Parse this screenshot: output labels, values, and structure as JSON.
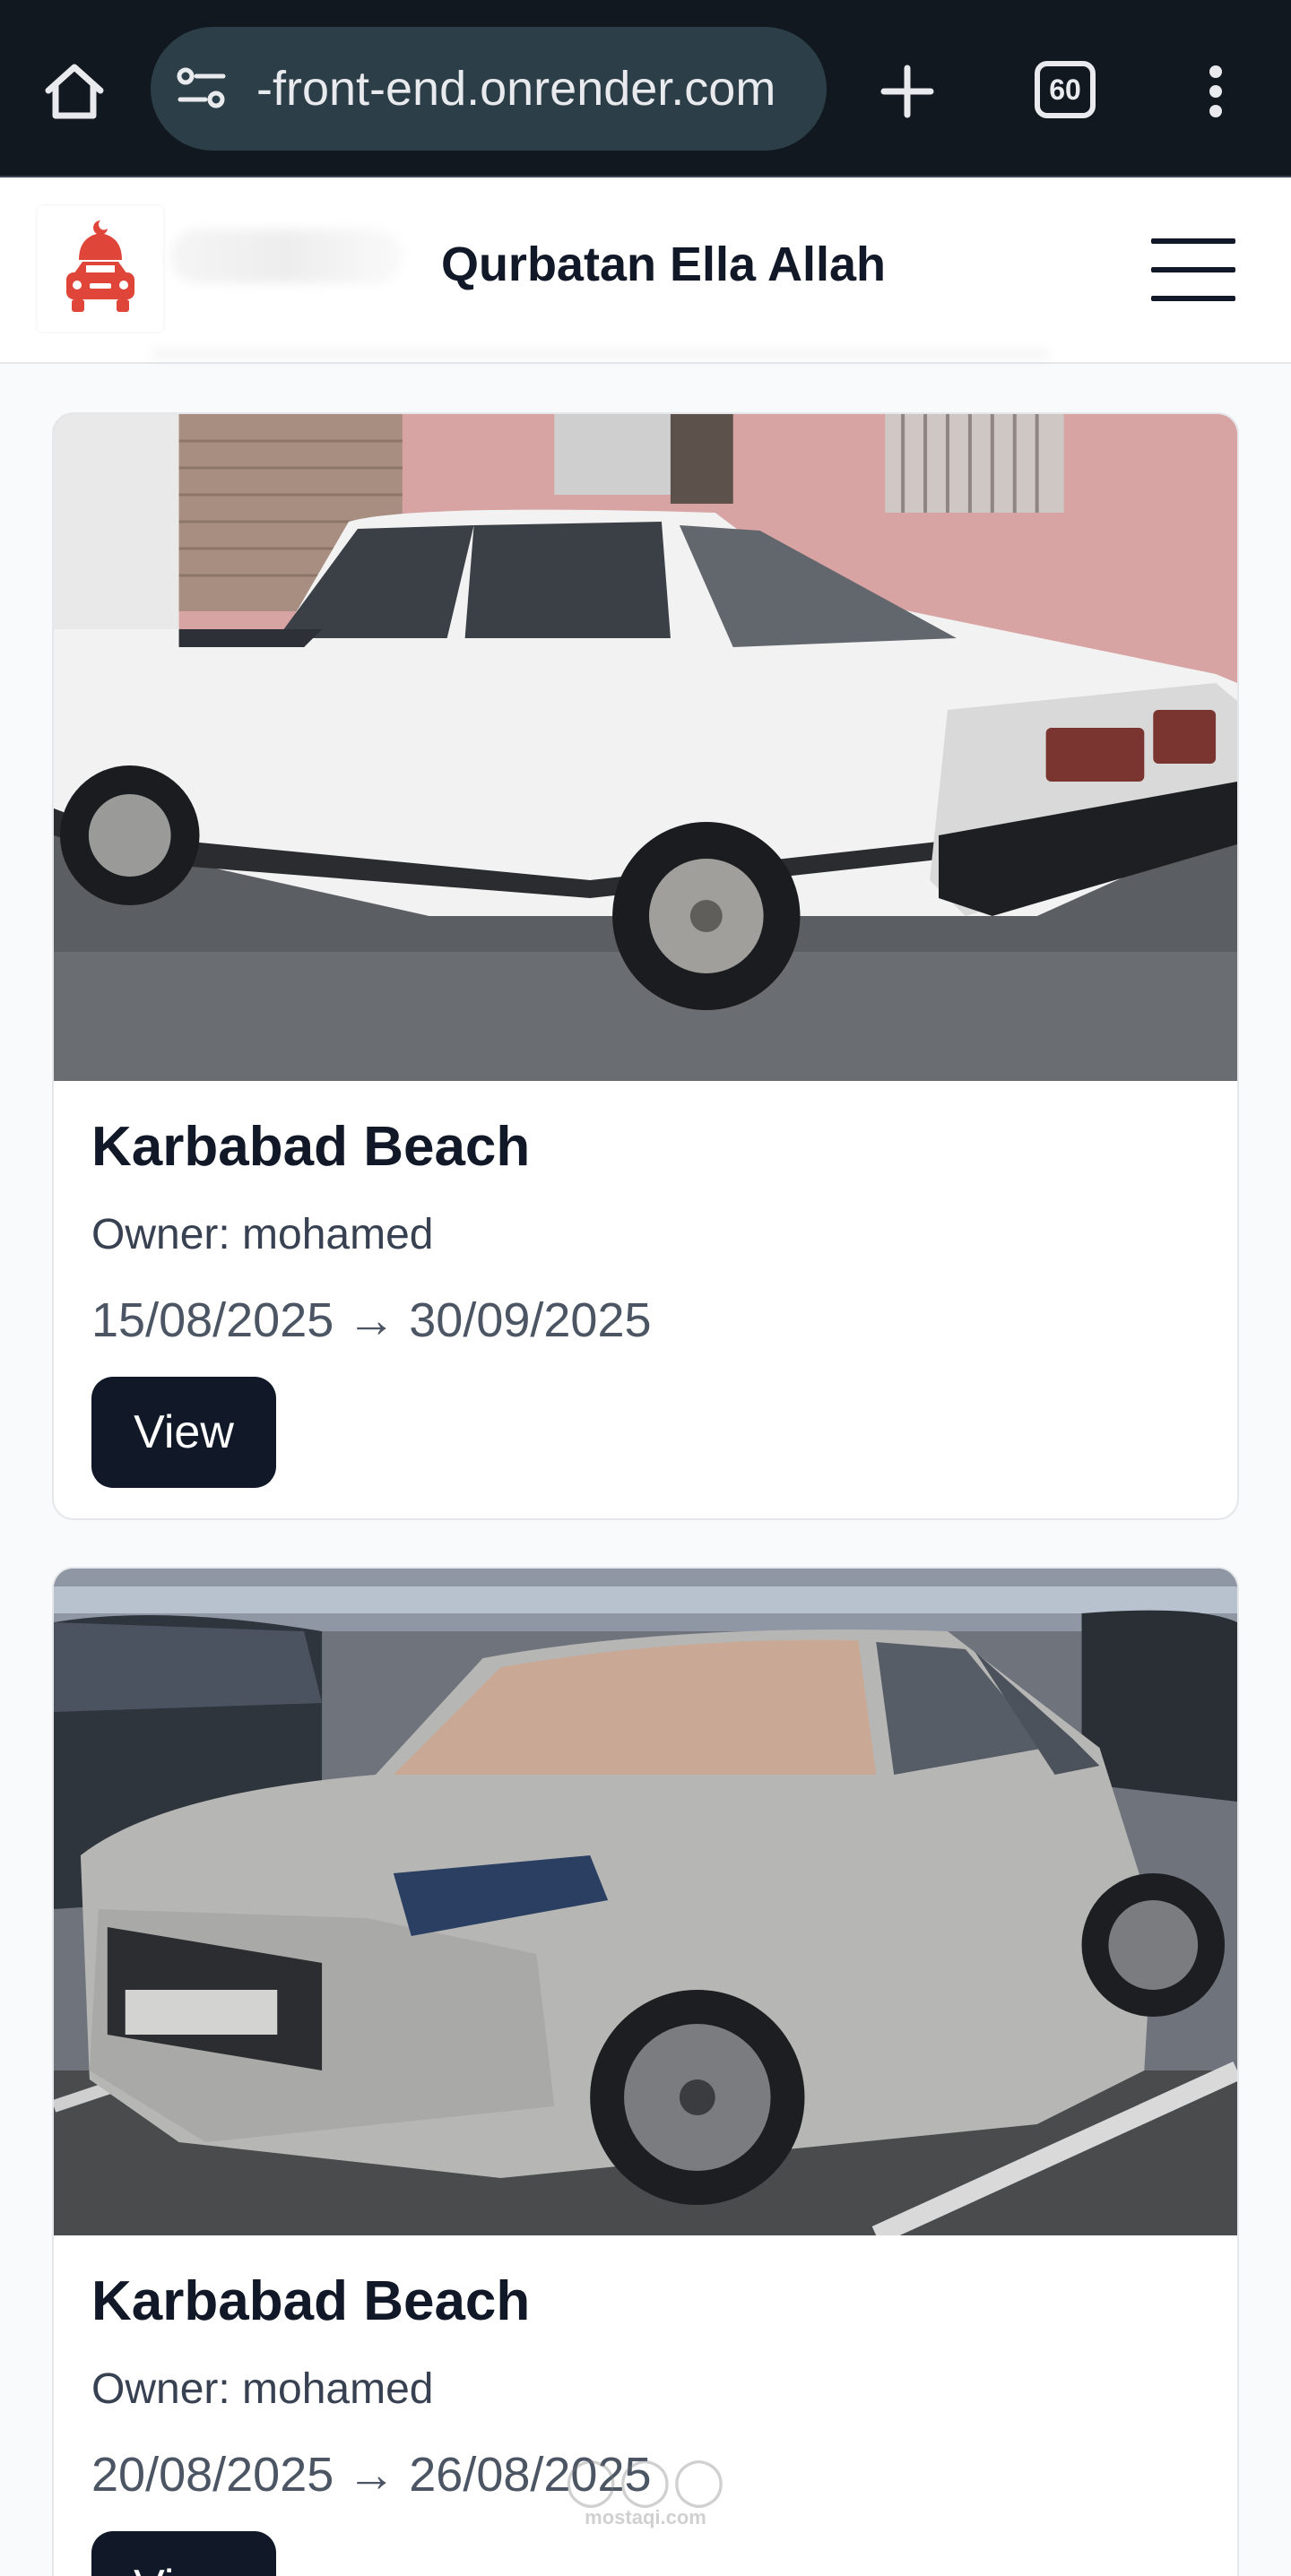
{
  "browser": {
    "url": "-front-end.onrender.com",
    "tab_count": "60"
  },
  "header": {
    "title": "Qurbatan Ella Allah"
  },
  "listings": [
    {
      "title": "Karbabad Beach",
      "owner": "Owner: mohamed",
      "dates": "15/08/2025 → 30/09/2025",
      "view_label": "View"
    },
    {
      "title": "Karbabad Beach",
      "owner": "Owner: mohamed",
      "dates": "20/08/2025 → 26/08/2025",
      "view_label": "View"
    }
  ],
  "watermark": {
    "text": "mostaqi.com"
  },
  "colors": {
    "chrome_bg": "#121820",
    "urlbar_bg": "#2c3e47",
    "primary_dark": "#111827",
    "page_bg": "#f9fafb",
    "logo_red": "#e0453a"
  }
}
